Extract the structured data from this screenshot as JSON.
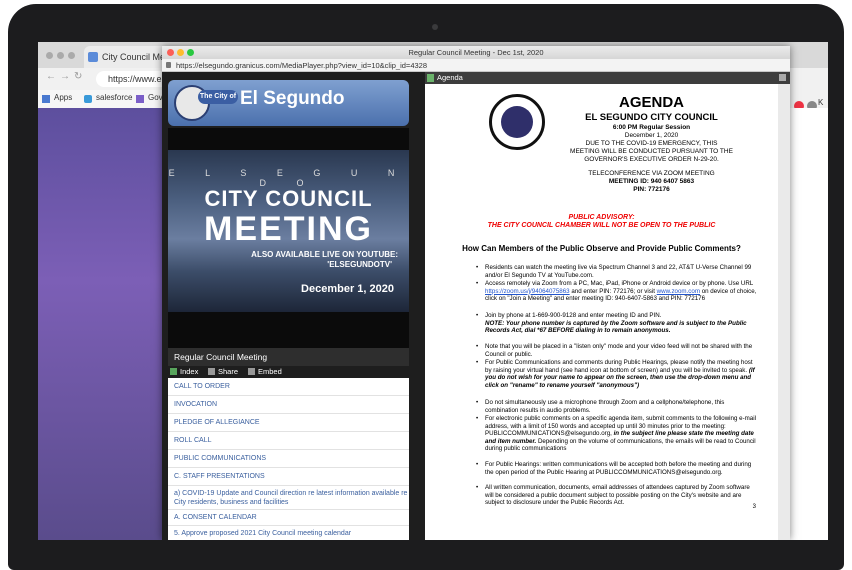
{
  "bg_browser": {
    "tab_title": "City Council Meeting",
    "url": "https://www.e",
    "bookmarks": [
      "Apps",
      "salesforce",
      "Gov"
    ],
    "right_label": "K"
  },
  "window": {
    "title": "Regular Council Meeting - Dec 1st, 2020",
    "url": "https://elsegundo.granicus.com/MediaPlayer.php?view_id=10&clip_id=4328"
  },
  "player": {
    "logo_pill": "The City of",
    "logo_name": "El Segundo",
    "video_el": "E L S E G U N D O",
    "video_line1": "CITY COUNCIL",
    "video_line2": "MEETING",
    "video_yt1": "ALSO AVAILABLE LIVE ON YOUTUBE:",
    "video_yt2": "'ELSEGUNDOTV'",
    "video_date": "December 1, 2020",
    "meeting_title": "Regular Council Meeting",
    "tabs": [
      "Index",
      "Share",
      "Embed"
    ],
    "index_items": [
      "CALL TO ORDER",
      "INVOCATION",
      "PLEDGE OF ALLEGIANCE",
      "ROLL CALL",
      "PUBLIC COMMUNICATIONS",
      "C. STAFF PRESENTATIONS",
      "a) COVID-19 Update and Council direction re latest information available re City residents, business and facilities",
      "A. CONSENT CALENDAR",
      "5. Approve proposed 2021 City Council meeting calendar"
    ]
  },
  "agenda": {
    "bar_label": "Agenda",
    "heading": "AGENDA",
    "council": "EL SEGUNDO CITY COUNCIL",
    "session": "6:00 PM Regular Session",
    "date": "December 1, 2020",
    "covid1": "DUE TO THE COVID-19 EMERGENCY, THIS",
    "covid2": "MEETING WILL BE CONDUCTED PURSUANT TO THE",
    "covid3": "GOVERNOR'S EXECUTIVE ORDER N-29-20.",
    "tele": "TELECONFERENCE VIA ZOOM MEETING",
    "meeting_id": "MEETING ID: 940 6407 5863",
    "pin": "PIN: 772176",
    "advisory1": "PUBLIC ADVISORY:",
    "advisory2": "THE CITY COUNCIL CHAMBER WILL NOT BE OPEN TO THE PUBLIC",
    "how": "How Can Members of the Public Observe and Provide Public Comments?",
    "b1": "Residents can watch the meeting live via Spectrum Channel 3 and 22, AT&T U-Verse Channel 99 and/or El Segundo TV at YouTube.com.",
    "b2a": "Access remotely via Zoom from a PC, Mac, iPad, iPhone or Android device or by phone. Use URL ",
    "b2link": "https://zoom.us/j/94064075863",
    "b2b": " and enter PIN: 772176; or visit ",
    "b2link2": "www.zoom.com",
    "b2c": " on device of choice, click on \"Join a Meeting\" and enter meeting ID: 940-6407-5863 and PIN: 772176",
    "b3a": "Join by phone at 1-669-900-9128 and enter meeting ID and PIN.",
    "b3b": "NOTE: Your phone number is captured by the Zoom software and is subject to the Public Records Act, dial *67 BEFORE dialing in to remain anonymous.",
    "b4": "Note that you will be placed in a \"listen only\" mode and your video feed will not be shared with the Council or public.",
    "b5a": "For Public Communications and comments during Public Hearings, please notify the meeting host by raising your virtual hand (see hand icon at bottom of screen) and you will be invited to speak. ",
    "b5b": "(If you do not wish for your name to appear on the screen, then use the drop-down menu and click on \"rename\" to rename yourself \"anonymous\")",
    "b6": "Do not simultaneously use a microphone through Zoom and a cellphone/telephone, this combination results in audio problems.",
    "b7a": "For electronic public comments on a specific agenda item, submit comments to the following e-mail address, with a limit of 150 words and accepted up until 30 minutes prior to the meeting: PUBLICCOMMUNICATIONS@elsegundo.org, ",
    "b7b": "in the subject line please state the meeting date and item number.",
    "b7c": " Depending on the volume of communications, the emails will be read to Council during public communications",
    "b8": "For Public Hearings: written communications will be accepted both before the meeting and during the open period of the Public Hearing at PUBLICCOMMUNICATIONS@elsegundo.org.",
    "b9": "All written communication, documents, email addresses of attendees captured by Zoom software will be considered a public document subject to possible posting on the City's website and are subject to disclosure under the Public Records Act.",
    "page": "3"
  }
}
